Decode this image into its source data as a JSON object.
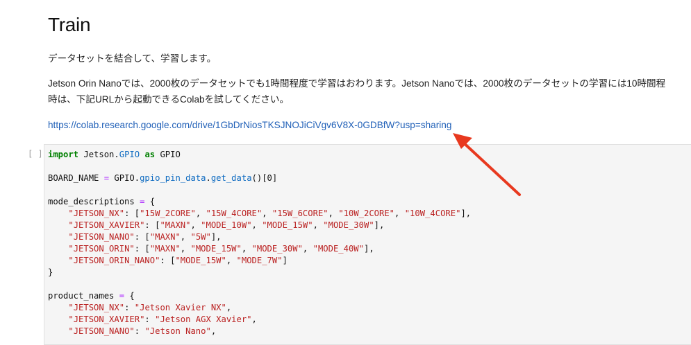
{
  "heading": "Train",
  "para1": "データセットを結合して、学習します。",
  "para2_line1": "Jetson Orin Nanoでは、2000枚のデータセットでも1時間程度で学習はおわります。Jetson Nanoでは、2000枚のデータセットの学習には10時間程",
  "para2_line2": "時は、下記URLから起動できるColabを試してください。",
  "link": "https://colab.research.google.com/drive/1GbDrNiosTKSJNOJiCiVgv6V8X-0GDBfW?usp=sharing",
  "prompt": "[ ]:",
  "colors": {
    "link": "#1f5fb7",
    "arrow": "#e8391f",
    "keyword": "#008000",
    "string": "#ba2121",
    "attr": "#0e6bc1"
  },
  "code_lines": [
    [
      {
        "t": "import",
        "c": "kw"
      },
      {
        "t": " Jetson."
      },
      {
        "t": "GPIO",
        "c": "attr"
      },
      {
        "t": " "
      },
      {
        "t": "as",
        "c": "kw"
      },
      {
        "t": " GPIO"
      }
    ],
    [],
    [
      {
        "t": "BOARD_NAME "
      },
      {
        "t": "=",
        "c": "op"
      },
      {
        "t": " GPIO."
      },
      {
        "t": "gpio_pin_data",
        "c": "attr"
      },
      {
        "t": "."
      },
      {
        "t": "get_data",
        "c": "attr"
      },
      {
        "t": "()["
      },
      {
        "t": "0"
      },
      {
        "t": "]"
      }
    ],
    [],
    [
      {
        "t": "mode_descriptions "
      },
      {
        "t": "=",
        "c": "op"
      },
      {
        "t": " {"
      }
    ],
    [
      {
        "t": "    "
      },
      {
        "t": "\"JETSON_NX\"",
        "c": "str"
      },
      {
        "t": ": ["
      },
      {
        "t": "\"15W_2CORE\"",
        "c": "str"
      },
      {
        "t": ", "
      },
      {
        "t": "\"15W_4CORE\"",
        "c": "str"
      },
      {
        "t": ", "
      },
      {
        "t": "\"15W_6CORE\"",
        "c": "str"
      },
      {
        "t": ", "
      },
      {
        "t": "\"10W_2CORE\"",
        "c": "str"
      },
      {
        "t": ", "
      },
      {
        "t": "\"10W_4CORE\"",
        "c": "str"
      },
      {
        "t": "],"
      }
    ],
    [
      {
        "t": "    "
      },
      {
        "t": "\"JETSON_XAVIER\"",
        "c": "str"
      },
      {
        "t": ": ["
      },
      {
        "t": "\"MAXN\"",
        "c": "str"
      },
      {
        "t": ", "
      },
      {
        "t": "\"MODE_10W\"",
        "c": "str"
      },
      {
        "t": ", "
      },
      {
        "t": "\"MODE_15W\"",
        "c": "str"
      },
      {
        "t": ", "
      },
      {
        "t": "\"MODE_30W\"",
        "c": "str"
      },
      {
        "t": "],"
      }
    ],
    [
      {
        "t": "    "
      },
      {
        "t": "\"JETSON_NANO\"",
        "c": "str"
      },
      {
        "t": ": ["
      },
      {
        "t": "\"MAXN\"",
        "c": "str"
      },
      {
        "t": ", "
      },
      {
        "t": "\"5W\"",
        "c": "str"
      },
      {
        "t": "],"
      }
    ],
    [
      {
        "t": "    "
      },
      {
        "t": "\"JETSON_ORIN\"",
        "c": "str"
      },
      {
        "t": ": ["
      },
      {
        "t": "\"MAXN\"",
        "c": "str"
      },
      {
        "t": ", "
      },
      {
        "t": "\"MODE_15W\"",
        "c": "str"
      },
      {
        "t": ", "
      },
      {
        "t": "\"MODE_30W\"",
        "c": "str"
      },
      {
        "t": ", "
      },
      {
        "t": "\"MODE_40W\"",
        "c": "str"
      },
      {
        "t": "],"
      }
    ],
    [
      {
        "t": "    "
      },
      {
        "t": "\"JETSON_ORIN_NANO\"",
        "c": "str"
      },
      {
        "t": ": ["
      },
      {
        "t": "\"MODE_15W\"",
        "c": "str"
      },
      {
        "t": ", "
      },
      {
        "t": "\"MODE_7W\"",
        "c": "str"
      },
      {
        "t": "]"
      }
    ],
    [
      {
        "t": "}"
      }
    ],
    [],
    [
      {
        "t": "product_names "
      },
      {
        "t": "=",
        "c": "op"
      },
      {
        "t": " {"
      }
    ],
    [
      {
        "t": "    "
      },
      {
        "t": "\"JETSON_NX\"",
        "c": "str"
      },
      {
        "t": ": "
      },
      {
        "t": "\"Jetson Xavier NX\"",
        "c": "str"
      },
      {
        "t": ","
      }
    ],
    [
      {
        "t": "    "
      },
      {
        "t": "\"JETSON_XAVIER\"",
        "c": "str"
      },
      {
        "t": ": "
      },
      {
        "t": "\"Jetson AGX Xavier\"",
        "c": "str"
      },
      {
        "t": ","
      }
    ],
    [
      {
        "t": "    "
      },
      {
        "t": "\"JETSON_NANO\"",
        "c": "str"
      },
      {
        "t": ": "
      },
      {
        "t": "\"Jetson Nano\"",
        "c": "str"
      },
      {
        "t": ","
      }
    ]
  ]
}
